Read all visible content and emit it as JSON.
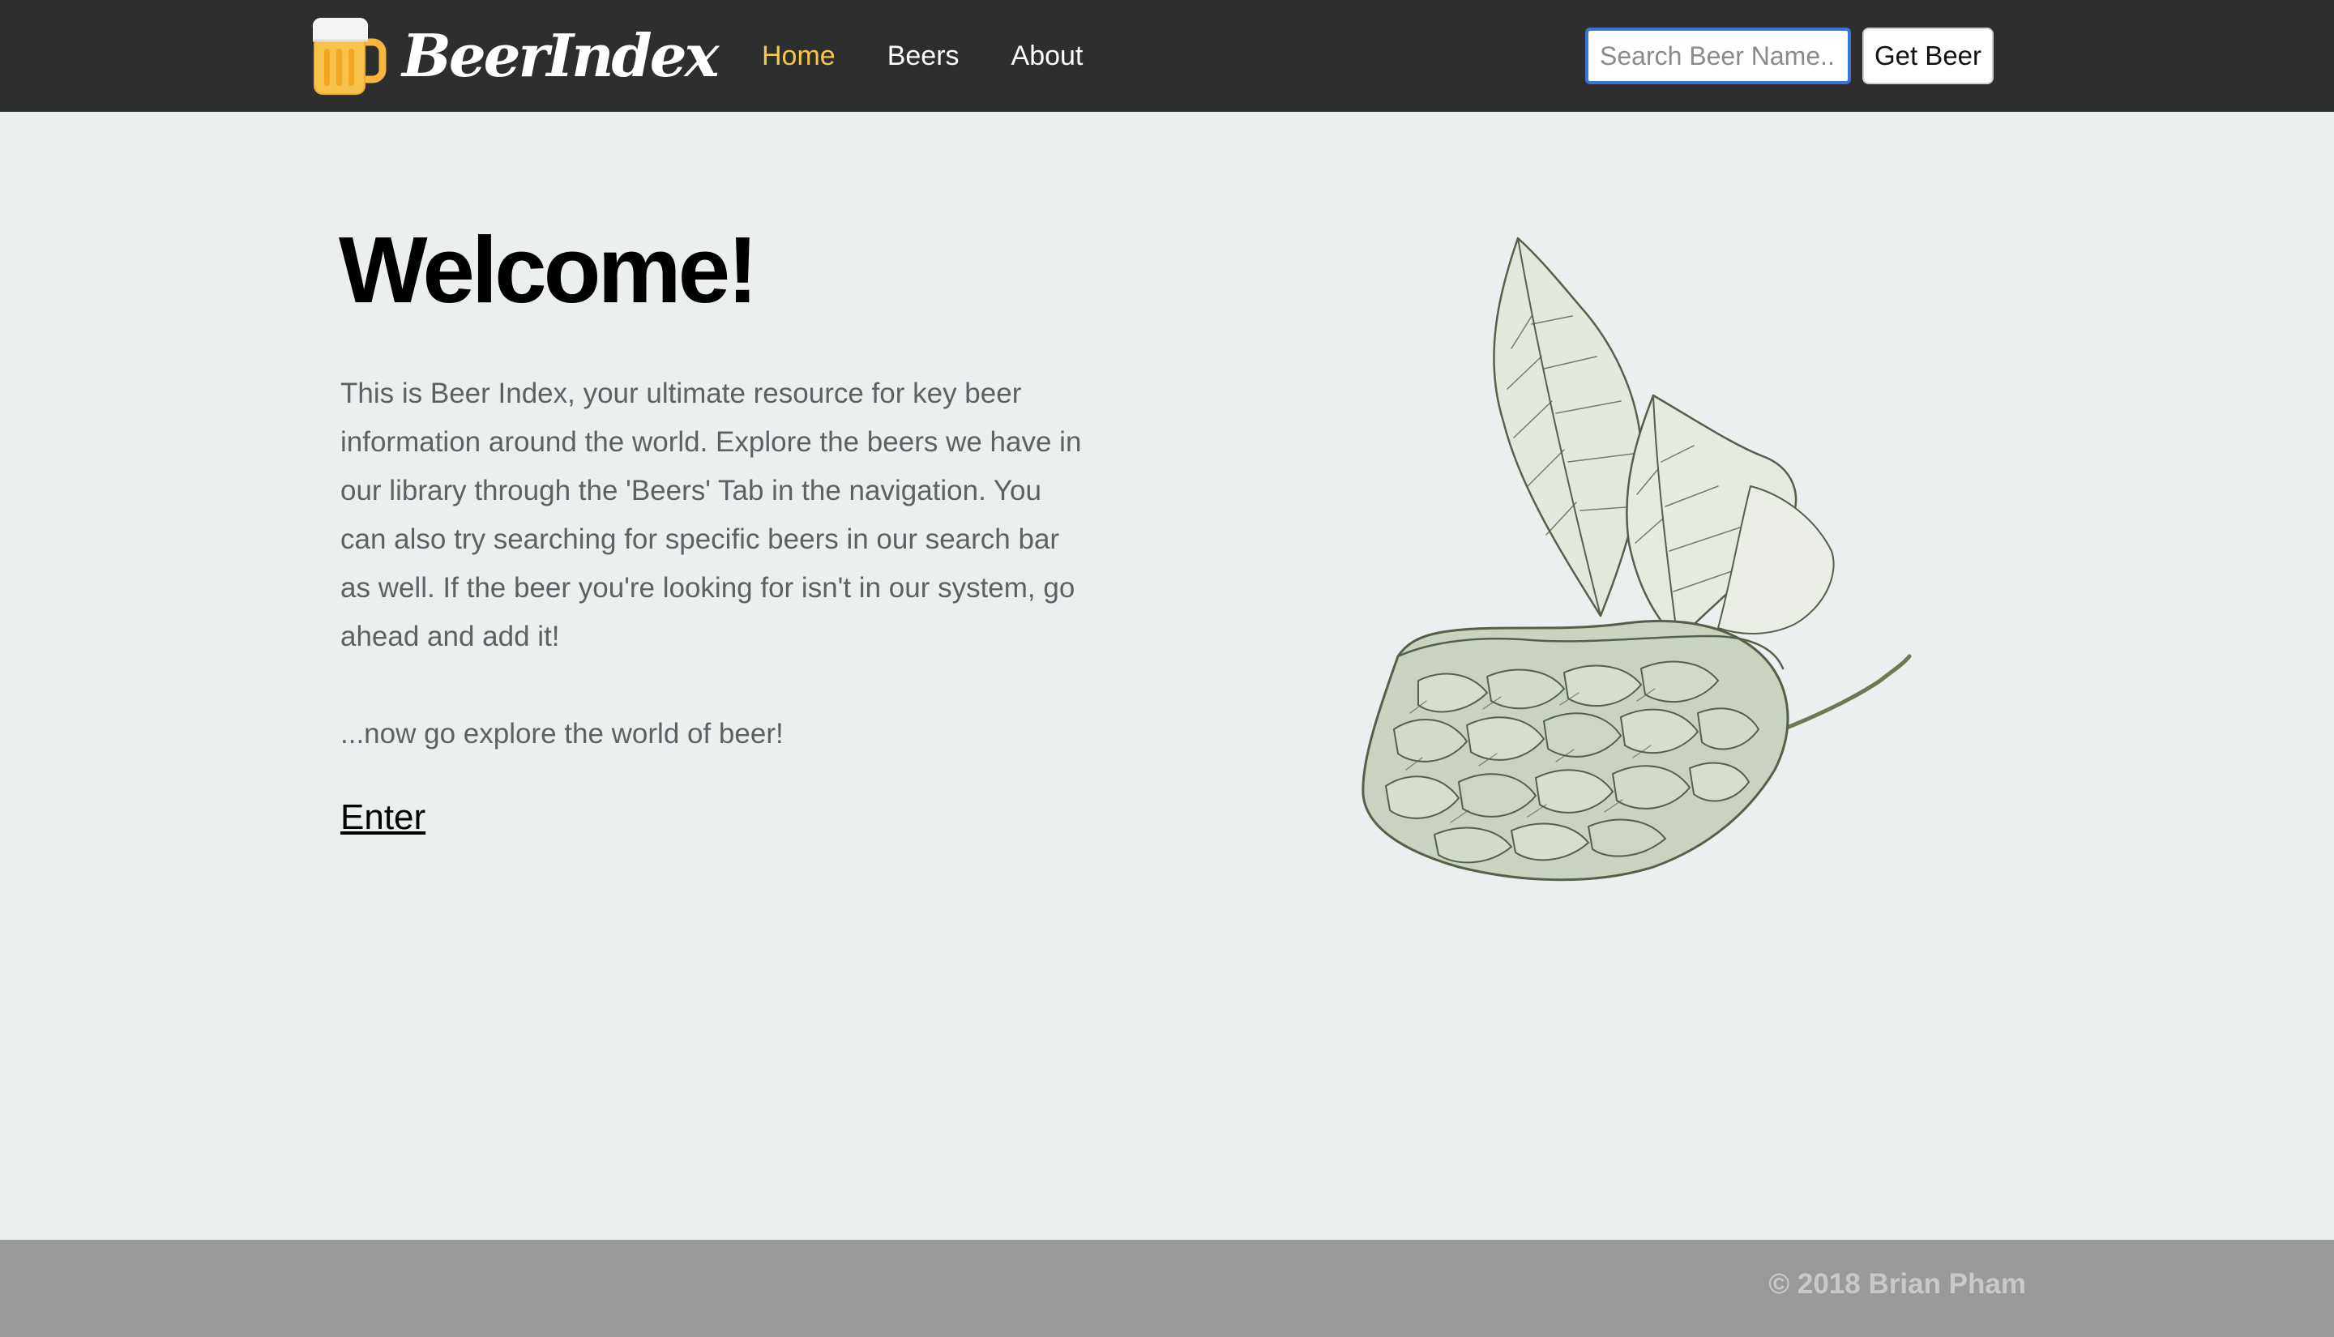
{
  "brand": {
    "name": "BeerIndex",
    "logo_icon": "beer-mug-icon"
  },
  "nav": {
    "items": [
      {
        "label": "Home",
        "active": true
      },
      {
        "label": "Beers",
        "active": false
      },
      {
        "label": "About",
        "active": false
      }
    ]
  },
  "search": {
    "placeholder": "Search Beer Name...",
    "value": "",
    "button_label": "Get Beer"
  },
  "main": {
    "title": "Welcome!",
    "intro": "This is Beer Index, your ultimate resource for key beer information around the world. Explore the beers we have in our library through the 'Beers' Tab in the navigation. You can also try searching for specific beers in our search bar as well. If the beer you're looking for isn't in our system, go ahead and add it!",
    "explore": "...now go explore the world of beer!",
    "enter_label": "Enter",
    "illustration_icon": "hop-illustration-icon"
  },
  "footer": {
    "copyright": "© 2018 Brian Pham"
  },
  "colors": {
    "navbar_bg": "#2d2f2f",
    "nav_active": "#f6c744",
    "page_bg": "#ebeff0",
    "footer_bg": "#9a9a9a",
    "search_focus": "#3b73d6"
  }
}
